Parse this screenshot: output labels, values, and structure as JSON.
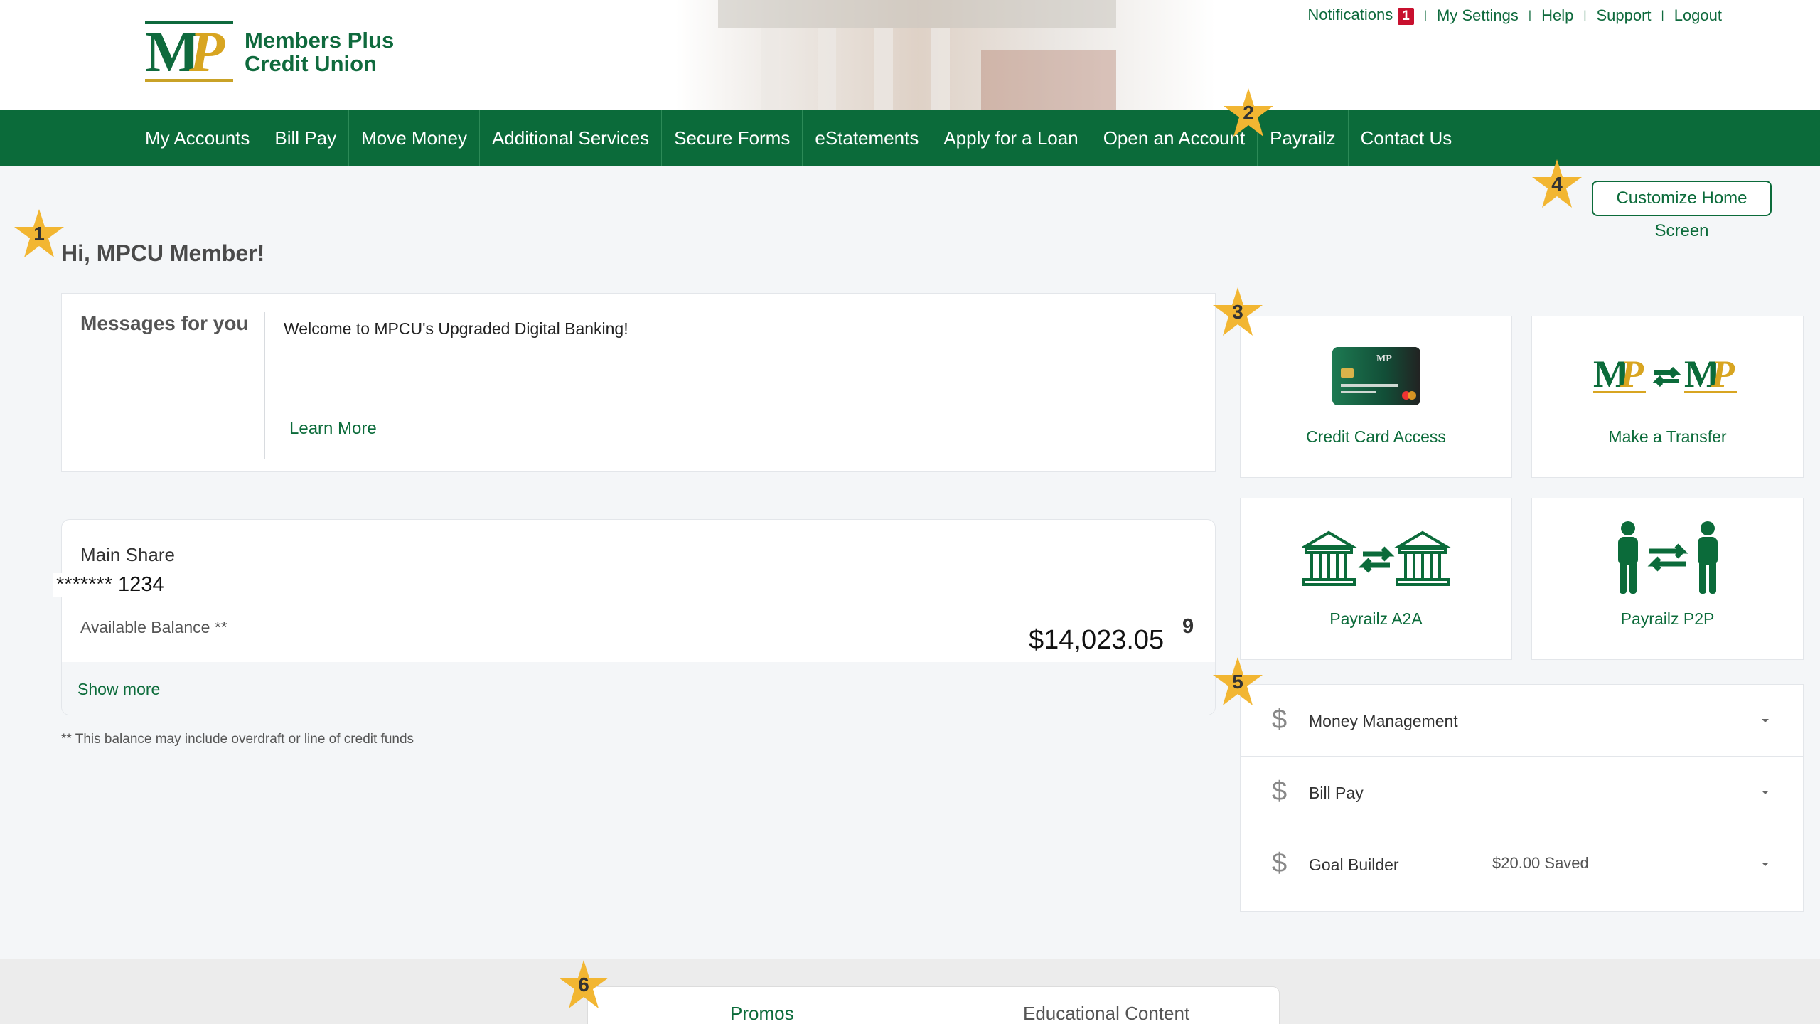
{
  "header": {
    "logo_mark_m": "M",
    "logo_mark_p": "P",
    "logo_line1": "Members Plus",
    "logo_line2": "Credit Union",
    "links": {
      "notifications": "Notifications",
      "notifications_count": "1",
      "my_settings": "My Settings",
      "help": "Help",
      "support": "Support",
      "logout": "Logout"
    }
  },
  "nav": {
    "items": [
      "My Accounts",
      "Bill Pay",
      "Move Money",
      "Additional Services",
      "Secure Forms",
      "eStatements",
      "Apply for a Loan",
      "Open an Account",
      "Payrailz",
      "Contact Us"
    ]
  },
  "customize_label": "Customize Home Screen",
  "greeting": "Hi, MPCU Member!",
  "messages": {
    "label": "Messages for you",
    "text": "Welcome to MPCU's Upgraded Digital Banking!",
    "learn_more": "Learn More"
  },
  "account": {
    "name": "Main Share",
    "number": "******* 1234",
    "balance_label": "Available Balance **",
    "balance": "$14,023.05",
    "ghost_digit": "9",
    "show_more": "Show more",
    "footnote": "** This balance may include overdraft or line of credit funds"
  },
  "tiles": [
    {
      "label": "Credit Card Access",
      "icon": "credit-card-icon"
    },
    {
      "label": "Make a Transfer",
      "icon": "mp-transfer-icon"
    },
    {
      "label": "Payrailz A2A",
      "icon": "bank-transfer-icon"
    },
    {
      "label": "Payrailz P2P",
      "icon": "person-transfer-icon"
    }
  ],
  "accordion": [
    {
      "label": "Money Management",
      "extra": "",
      "icon": "dollar-icon"
    },
    {
      "label": "Bill Pay",
      "extra": "",
      "icon": "dollar-icon"
    },
    {
      "label": "Goal Builder",
      "extra": "$20.00 Saved",
      "icon": "dollar-icon"
    }
  ],
  "bottom_tabs": {
    "promos": "Promos",
    "educational": "Educational Content"
  },
  "annotations": [
    "1",
    "2",
    "3",
    "4",
    "5",
    "6"
  ],
  "colors": {
    "brand_green": "#0b6b3a",
    "brand_gold": "#d8a521",
    "badge_red": "#c8102e",
    "star_gold": "#f2b632"
  }
}
